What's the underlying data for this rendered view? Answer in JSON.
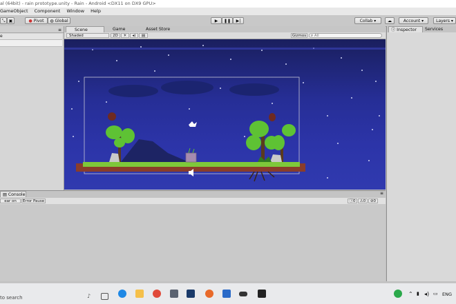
{
  "window": {
    "title": "al (64bit) - rain prototype.unity - Rain - Android <DX11 on DX9 GPU>",
    "menu": [
      "GameObject",
      "Component",
      "Window",
      "Help"
    ]
  },
  "toolbar": {
    "pivot_label": "Pivot",
    "global_label": "Global",
    "collab_label": "Collab",
    "account_label": "Account",
    "layers_label": "Layers"
  },
  "hierarchy": {
    "search_text": "e"
  },
  "scene": {
    "tabs": [
      "Scene",
      "Game",
      "Asset Store"
    ],
    "shading_mode": "Shaded",
    "mode_2d_label": "2D",
    "gizmos_label": "Gizmos",
    "search_placeholder": "All"
  },
  "console": {
    "tab_label": "Console",
    "buttons": [
      "ear on Play",
      "Error Pause"
    ],
    "counts": [
      "0",
      "0",
      "0"
    ]
  },
  "inspector": {
    "tabs": [
      "Inspector",
      "Services"
    ]
  },
  "taskbar": {
    "search_placeholder": "to search",
    "language": "ENG"
  },
  "colors": {
    "sky_top": "#1a1f5e",
    "sky_bottom": "#303aaf",
    "grass": "#7ec83a",
    "soil": "#8a3d2a",
    "tree_leaves": "#5ec234"
  }
}
